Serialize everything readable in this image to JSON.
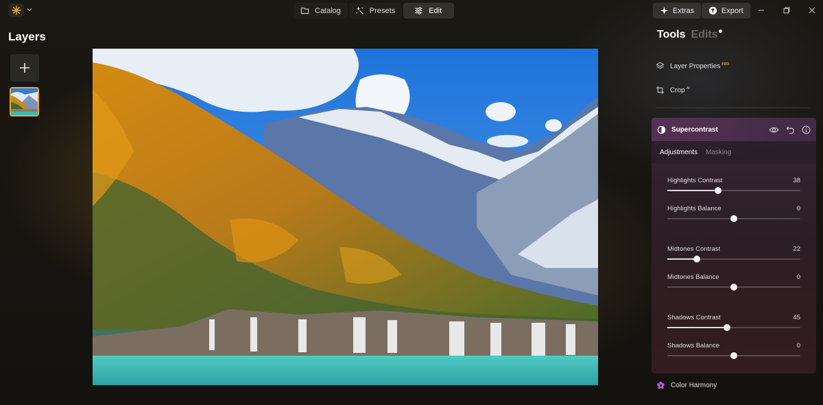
{
  "topbar": {
    "nav": [
      {
        "label": "Catalog",
        "icon": "folder-icon"
      },
      {
        "label": "Presets",
        "icon": "sparkle-wand-icon"
      },
      {
        "label": "Edit",
        "icon": "sliders-icon",
        "active": true
      }
    ],
    "extras_label": "Extras",
    "export_label": "Export"
  },
  "layers": {
    "title": "Layers"
  },
  "right_panel": {
    "tabs": {
      "tools": "Tools",
      "edits": "Edits"
    },
    "tools": [
      {
        "label": "Layer Properties",
        "badge": "PRO"
      },
      {
        "label": "Crop",
        "badge": "AI"
      }
    ],
    "supercontrast": {
      "title": "Supercontrast",
      "subtabs": {
        "adjustments": "Adjustments",
        "masking": "Masking"
      },
      "sliders": [
        {
          "label": "Highlights Contrast",
          "value": "38",
          "level": 0.38,
          "bipolar": false
        },
        {
          "label": "Highlights Balance",
          "value": "0",
          "level": 0.5,
          "bipolar": true
        },
        {
          "label": "Midtones Contrast",
          "value": "22",
          "level": 0.22,
          "bipolar": false
        },
        {
          "label": "Midtones Balance",
          "value": "0",
          "level": 0.5,
          "bipolar": true
        },
        {
          "label": "Shadows Contrast",
          "value": "45",
          "level": 0.45,
          "bipolar": false
        },
        {
          "label": "Shadows Balance",
          "value": "0",
          "level": 0.5,
          "bipolar": true
        }
      ]
    },
    "color_harmony_label": "Color Harmony"
  },
  "colors": {
    "accent": "#e3a82b",
    "panel_header": "#6e3c6e",
    "knob": "#f1f1f1"
  }
}
